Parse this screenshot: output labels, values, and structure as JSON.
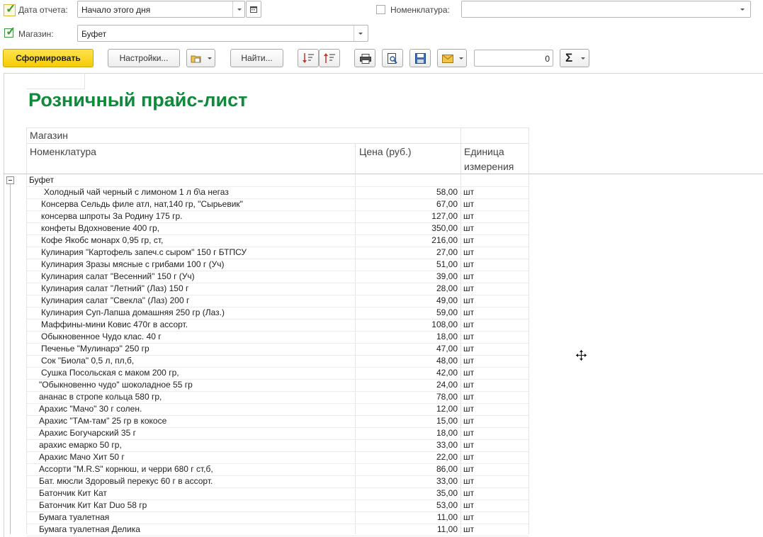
{
  "filters": {
    "date_label": "Дата отчета:",
    "date_value": "Начало этого дня",
    "nomenclature_label": "Номенклатура:",
    "nomenclature_value": "",
    "store_label": "Магазин:",
    "store_value": "Буфет",
    "date_checked": true,
    "store_checked": true,
    "nomenclature_checked": false
  },
  "toolbar": {
    "generate_label": "Сформировать",
    "settings_label": "Настройки...",
    "find_label": "Найти...",
    "counter_value": "0",
    "sum_symbol": "Σ"
  },
  "report": {
    "title": "Розничный прайс-лист",
    "header_store": "Магазин",
    "header_nomenclature": "Номенклатура",
    "header_price": "Цена (руб.)",
    "header_unit_line1": "Единица",
    "header_unit_line2": "измерения",
    "group_name": "Буфет",
    "group_toggle": "−",
    "rows": [
      {
        "name": "Холодный чай черный  с лимоном 1 л б\\а негаз",
        "price": "58,00",
        "unit": "шт",
        "indent": 24
      },
      {
        "name": "Консерва Сельдь филе атл, нат,140 гр, \"Сырьевик\"",
        "price": "67,00",
        "unit": "шт",
        "indent": 20
      },
      {
        "name": "консерва шпроты  За Родину 175 гр.",
        "price": "127,00",
        "unit": "шт",
        "indent": 20
      },
      {
        "name": "конфеты Вдохновение 400 гр,",
        "price": "350,00",
        "unit": "шт",
        "indent": 20
      },
      {
        "name": "Кофе Якобс монарх 0,95 гр, ст,",
        "price": "216,00",
        "unit": "шт",
        "indent": 20
      },
      {
        "name": "Кулинария \"Картофель запеч.с сыром\" 150 г БТПСУ",
        "price": "27,00",
        "unit": "шт",
        "indent": 20
      },
      {
        "name": "Кулинария Зразы мясные с грибами 100 г (Уч)",
        "price": "51,00",
        "unit": "шт",
        "indent": 20
      },
      {
        "name": "Кулинария салат \"Весенний\" 150 г (Уч)",
        "price": "39,00",
        "unit": "шт",
        "indent": 20
      },
      {
        "name": "Кулинария салат \"Летний\" (Лаз) 150 г",
        "price": "28,00",
        "unit": "шт",
        "indent": 20
      },
      {
        "name": "Кулинария салат \"Свекла\" (Лаз) 200 г",
        "price": "49,00",
        "unit": "шт",
        "indent": 20
      },
      {
        "name": "Кулинария Суп-Лапша домашняя 250 гр (Лаз.)",
        "price": "59,00",
        "unit": "шт",
        "indent": 20
      },
      {
        "name": "Маффины-мини Ковис 470г в ассорт.",
        "price": "108,00",
        "unit": "шт",
        "indent": 20
      },
      {
        "name": "Обыкновенное Чудо клас. 40 г",
        "price": "18,00",
        "unit": "шт",
        "indent": 20
      },
      {
        "name": "Печенье \"Мулинарэ\" 250 гр",
        "price": "47,00",
        "unit": "шт",
        "indent": 20
      },
      {
        "name": "Сок \"Биола\" 0,5 л, пл,б,",
        "price": "48,00",
        "unit": "шт",
        "indent": 20
      },
      {
        "name": "Сушка Посольская с маком 200 гр,",
        "price": "42,00",
        "unit": "шт",
        "indent": 20
      },
      {
        "name": "\"Обыкновенно чудо\" шоколадное 55 гр",
        "price": "24,00",
        "unit": "шт",
        "indent": 17
      },
      {
        "name": "ананас в стропе кольца 580 гр,",
        "price": "78,00",
        "unit": "шт",
        "indent": 17
      },
      {
        "name": "Арахис \"Мачо\" 30 г солен.",
        "price": "12,00",
        "unit": "шт",
        "indent": 17
      },
      {
        "name": "Арахис \"ТАм-там\" 25 гр в кокосе",
        "price": "15,00",
        "unit": "шт",
        "indent": 17
      },
      {
        "name": "Арахис Богучарский 35 г",
        "price": "18,00",
        "unit": "шт",
        "indent": 17
      },
      {
        "name": "арахис емарко 50 гр,",
        "price": "33,00",
        "unit": "шт",
        "indent": 17
      },
      {
        "name": "Арахис Мачо Хит 50 г",
        "price": "22,00",
        "unit": "шт",
        "indent": 17
      },
      {
        "name": "Ассорти \"M.R.S\" корнюш, и черри 680 г ст,б,",
        "price": "86,00",
        "unit": "шт",
        "indent": 17
      },
      {
        "name": "Бат. мюсли Здоровый перекус 60 г в ассорт.",
        "price": "33,00",
        "unit": "шт",
        "indent": 17
      },
      {
        "name": "Батончик Кит Кат",
        "price": "35,00",
        "unit": "шт",
        "indent": 17
      },
      {
        "name": "Батончик Кит Кат Duo 58 гр",
        "price": "53,00",
        "unit": "шт",
        "indent": 17
      },
      {
        "name": "Бумага туалетная",
        "price": "11,00",
        "unit": "шт",
        "indent": 17
      },
      {
        "name": "Бумага туалетная Делика",
        "price": "11,00",
        "unit": "шт",
        "indent": 17
      }
    ]
  },
  "colors": {
    "title": "#0d8a3a",
    "primary_button": "#f5cc05",
    "check": "#3c9a3c"
  }
}
